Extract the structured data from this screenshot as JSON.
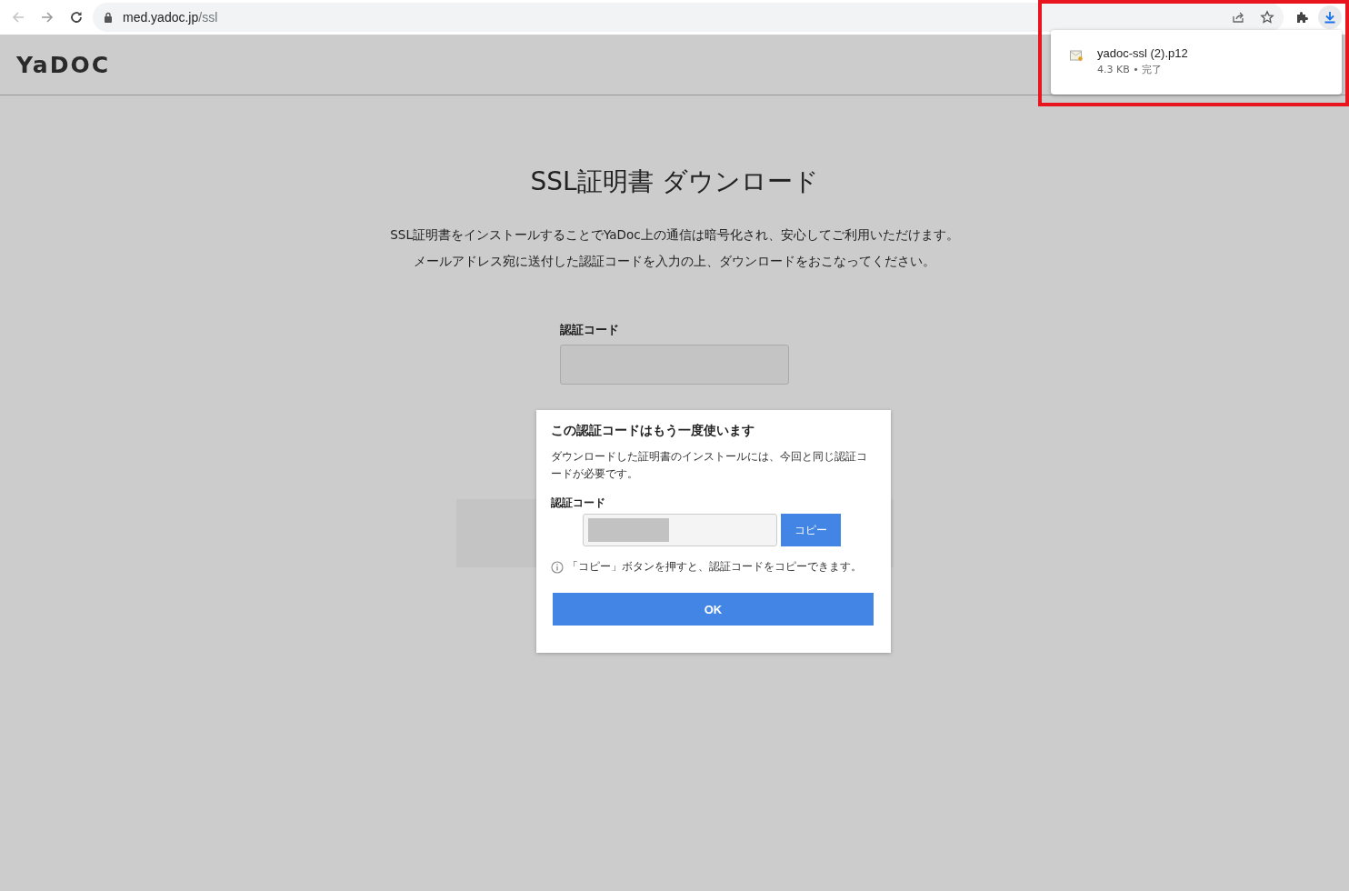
{
  "browser": {
    "url_host": "med.yadoc.jp",
    "url_path": "/ssl"
  },
  "download_popup": {
    "file_name": "yadoc-ssl (2).p12",
    "size": "4.3 KB",
    "separator": "•",
    "status": "完了"
  },
  "page": {
    "logo": "YaDOC",
    "title": "SSL証明書 ダウンロード",
    "description": [
      "SSL証明書をインストールすることでYaDoc上の通信は暗号化され、安心してご利用いただけます。",
      "メールアドレス宛に送付した認証コードを入力の上、ダウンロードをおこなってください。"
    ],
    "code_label": "認証コード"
  },
  "dialog": {
    "title": "この認証コードはもう一度使います",
    "body": "ダウンロードした証明書のインストールには、今回と同じ認証コードが必要です。",
    "code_label": "認証コード",
    "copy_button": "コピー",
    "hint": "「コピー」ボタンを押すと、認証コードをコピーできます。",
    "ok_button": "OK"
  }
}
